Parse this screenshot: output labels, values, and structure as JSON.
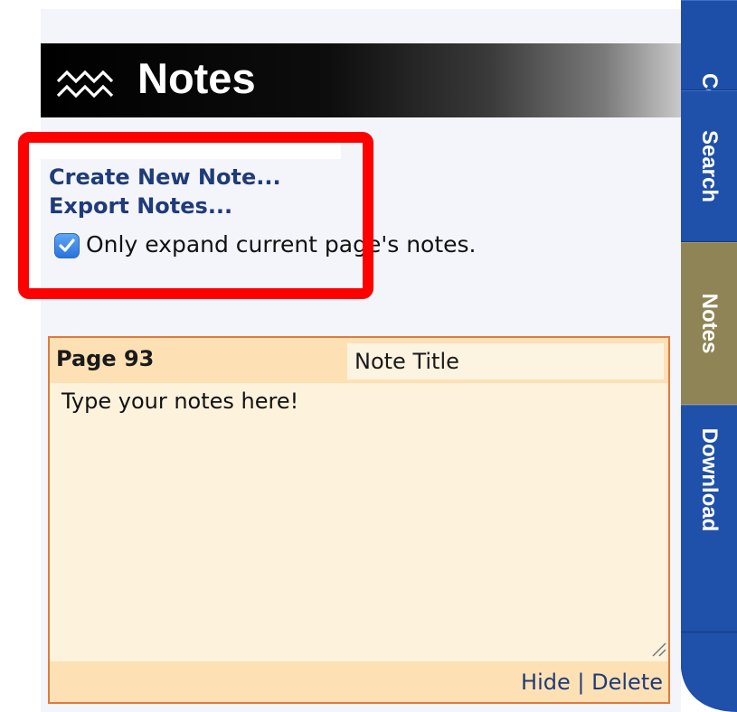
{
  "header": {
    "title": "Notes",
    "icon": "aquarius-waves-icon"
  },
  "links": {
    "create_new_note": "Create New Note...",
    "export_notes": "Export Notes..."
  },
  "options": {
    "only_expand_current_label": "Only expand current page's notes.",
    "only_expand_checked": true
  },
  "note": {
    "page_label": "Page 93",
    "title_value": "Note Title",
    "body_value": "Type your notes here!",
    "hide_label": "Hide",
    "separator": "|",
    "delete_label": "Delete"
  },
  "tabs": [
    {
      "label": "Contents",
      "active": false
    },
    {
      "label": "Search",
      "active": false
    },
    {
      "label": "Notes",
      "active": true
    },
    {
      "label": "Download",
      "active": false
    }
  ],
  "colors": {
    "link": "#1f3b79",
    "tab_blue": "#1f50aa",
    "tab_active": "#8f8455",
    "note_bg": "#fdf2dc",
    "note_border": "#e07a3b",
    "highlight": "#ff0000"
  }
}
